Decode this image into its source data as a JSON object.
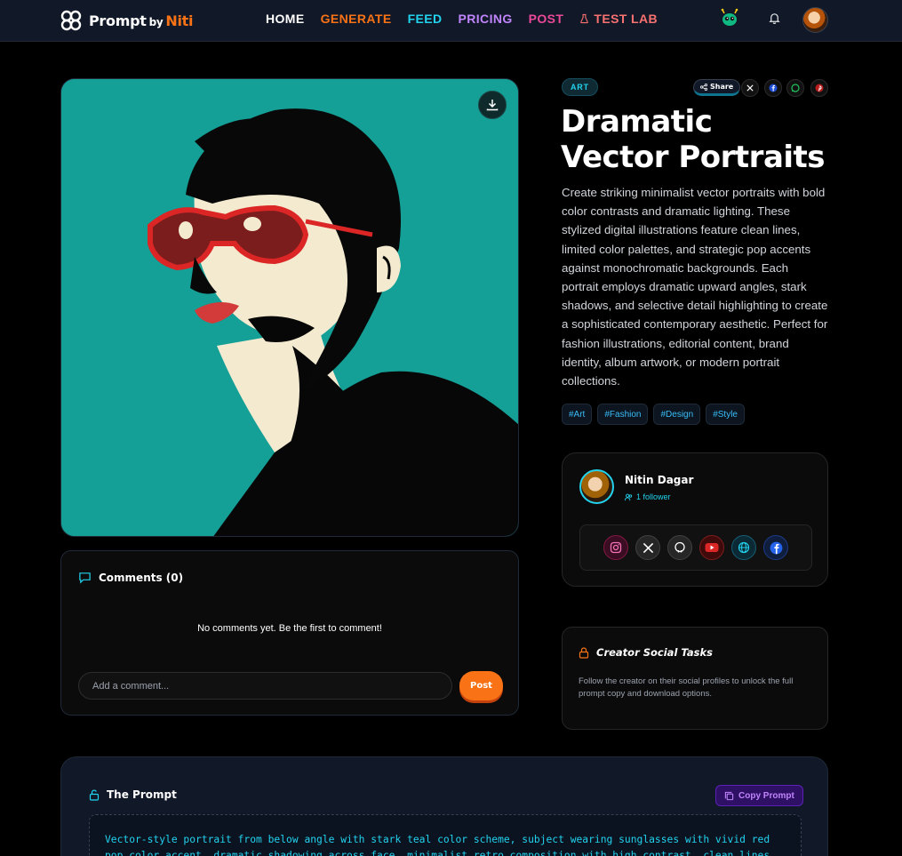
{
  "nav": {
    "logo_main": "Prompt",
    "logo_by": "by",
    "logo_brand": "Niti",
    "links": [
      {
        "label": "HOME",
        "color": "#ffffff"
      },
      {
        "label": "GENERATE",
        "color": "#f97316"
      },
      {
        "label": "FEED",
        "color": "#22d3ee"
      },
      {
        "label": "PRICING",
        "color": "#c084fc"
      },
      {
        "label": "POST",
        "color": "#ec4899"
      },
      {
        "label": "TEST LAB",
        "color": "#f87171"
      }
    ]
  },
  "post": {
    "category": "ART",
    "share_label": "Share",
    "title": "Dramatic Vector Portraits",
    "description": "Create striking minimalist vector portraits with bold color contrasts and dramatic lighting. These stylized digital illustrations feature clean lines, limited color palettes, and strategic pop accents against monochromatic backgrounds. Each portrait employs dramatic upward angles, stark shadows, and selective detail highlighting to create a sophisticated contemporary aesthetic. Perfect for fashion illustrations, editorial content, brand identity, album artwork, or modern portrait collections.",
    "tags": [
      "#Art",
      "#Fashion",
      "#Design",
      "#Style"
    ]
  },
  "comments": {
    "title": "Comments (0)",
    "empty_text": "No comments yet. Be the first to comment!",
    "input_placeholder": "Add a comment...",
    "post_label": "Post"
  },
  "creator": {
    "name": "Nitin Dagar",
    "followers": "1 follower"
  },
  "tasks": {
    "title": "Creator Social Tasks",
    "description": "Follow the creator on their social profiles to unlock the full prompt copy and download options."
  },
  "prompt": {
    "title": "The Prompt",
    "copy_label": "Copy Prompt",
    "text": "Vector-style portrait from below angle with stark teal color scheme, subject wearing sunglasses with vivid red pop color accent, dramatic shadowing across face, minimalist retro composition with high contrast, clean lines and flat"
  },
  "colors": {
    "accent_orange": "#f97316",
    "accent_cyan": "#22d3ee",
    "art_teal": "#149f97"
  }
}
